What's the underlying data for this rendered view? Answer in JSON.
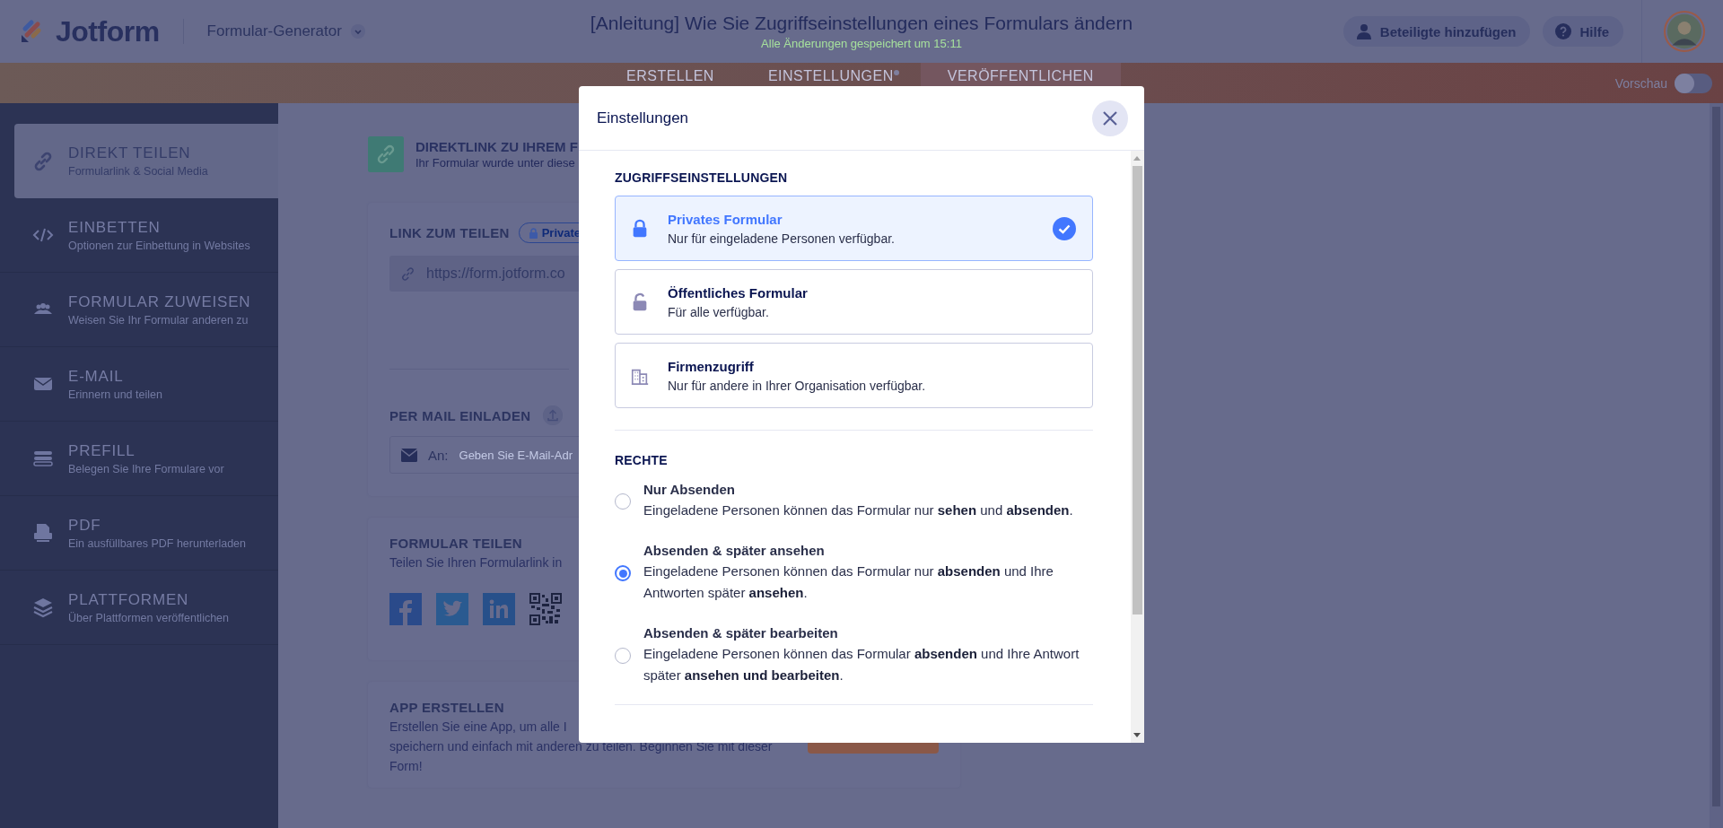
{
  "header": {
    "logo": "Jotform",
    "product": "Formular-Generator",
    "title": "[Anleitung] Wie Sie Zugriffseinstellungen eines Formulars ändern",
    "saved_status": "Alle Änderungen gespeichert um 15:11",
    "buttons": [
      {
        "label": "Beteiligte hinzufügen",
        "kind": "person"
      },
      {
        "label": "Hilfe",
        "kind": "help"
      }
    ]
  },
  "nav": {
    "tabs": [
      {
        "label": "ERSTELLEN",
        "selected": false,
        "dot": false
      },
      {
        "label": "EINSTELLUNGEN",
        "selected": false,
        "dot": true
      },
      {
        "label": "VERÖFFENTLICHEN",
        "selected": true,
        "dot": false
      }
    ],
    "preview": {
      "label": "Vorschau",
      "on": false
    }
  },
  "sidebar": {
    "items": [
      {
        "title": "DIREKT TEILEN",
        "subtitle": "Formularlink & Social Media",
        "kind": "link",
        "selected": true
      },
      {
        "title": "EINBETTEN",
        "subtitle": "Optionen zur Einbettung in Websites",
        "kind": "code",
        "selected": false
      },
      {
        "title": "FORMULAR ZUWEISEN",
        "subtitle": "Weisen Sie Ihr Formular anderen zu",
        "kind": "people",
        "selected": false
      },
      {
        "title": "E-MAIL",
        "subtitle": "Erinnern und teilen",
        "kind": "mail",
        "selected": false
      },
      {
        "title": "PREFILL",
        "subtitle": "Belegen Sie Ihre Formulare vor",
        "kind": "prefill",
        "selected": false
      },
      {
        "title": "PDF",
        "subtitle": "Ein ausfüllbares PDF herunterladen",
        "kind": "pdf",
        "selected": false
      },
      {
        "title": "PLATTFORMEN",
        "subtitle": "Über Plattformen veröffentlichen",
        "kind": "layers",
        "selected": false
      }
    ]
  },
  "content": {
    "direct_link": {
      "title": "DIREKTLINK ZU IHREM F",
      "subtitle": "Ihr Formular wurde unter diese"
    },
    "share_link": {
      "label": "LINK ZUM TEILEN",
      "badge": "Private",
      "url": "https://form.jotform.co"
    },
    "invite": {
      "label": "PER MAIL EINLADEN",
      "to_label": "An:",
      "placeholder": "Geben Sie E-Mail-Adr"
    },
    "share_form": {
      "title": "FORMULAR TEILEN",
      "subtitle": "Teilen Sie Ihren Formularlink in",
      "social": [
        {
          "kind": "facebook"
        },
        {
          "kind": "twitter"
        },
        {
          "kind": "linkedin"
        },
        {
          "kind": "qr"
        }
      ]
    },
    "app": {
      "title": "APP ERSTELLEN",
      "lines": [
        "Erstellen Sie eine App, um alle I",
        "speichern und einfach mit anderen zu teilen. Beginnen Sie mit dieser",
        "Form!"
      ]
    }
  },
  "modal": {
    "title": "Einstellungen",
    "access": {
      "heading": "ZUGRIFFSEINSTELLUNGEN",
      "options": [
        {
          "title": "Privates Formular",
          "description": "Nur für eingeladene Personen verfügbar.",
          "kind": "lock",
          "selected": true
        },
        {
          "title": "Öffentliches Formular",
          "description": "Für alle verfügbar.",
          "kind": "unlock",
          "selected": false
        },
        {
          "title": "Firmenzugriff",
          "description": "Nur für andere in Ihrer Organisation verfügbar.",
          "kind": "building",
          "selected": false
        }
      ]
    },
    "rights": {
      "heading": "RECHTE",
      "options": [
        {
          "title": "Nur Absenden",
          "description": "Eingeladene Personen können das Formular nur **sehen** und **absenden**.",
          "selected": false
        },
        {
          "title": "Absenden & später ansehen",
          "description": "Eingeladene Personen können das Formular nur **absenden** und Ihre Antworten später **ansehen**.",
          "selected": true
        },
        {
          "title": "Absenden & später bearbeiten",
          "description": "Eingeladene Personen können das Formular **absenden** und Ihre Antwort später **ansehen und bearbeiten**.",
          "selected": false
        }
      ]
    }
  }
}
